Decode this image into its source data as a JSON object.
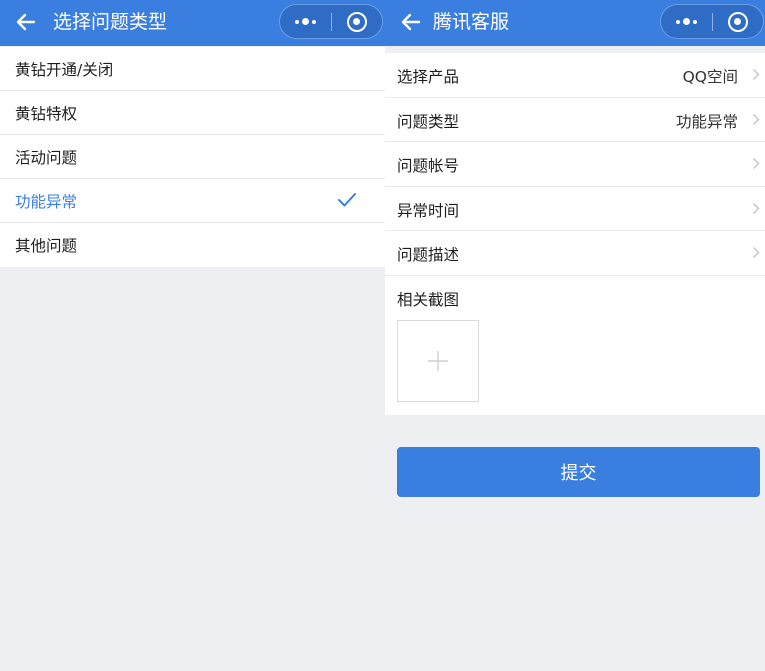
{
  "left": {
    "nav": {
      "title": "选择问题类型"
    },
    "options": [
      {
        "label": "黄钻开通/关闭",
        "selected": false
      },
      {
        "label": "黄钻特权",
        "selected": false
      },
      {
        "label": "活动问题",
        "selected": false
      },
      {
        "label": "功能异常",
        "selected": true
      },
      {
        "label": "其他问题",
        "selected": false
      }
    ]
  },
  "right": {
    "nav": {
      "title": "腾讯客服"
    },
    "form": {
      "rows": [
        {
          "label": "选择产品",
          "value": "QQ空间"
        },
        {
          "label": "问题类型",
          "value": "功能异常"
        },
        {
          "label": "问题帐号",
          "value": ""
        },
        {
          "label": "异常时间",
          "value": ""
        },
        {
          "label": "问题描述",
          "value": ""
        }
      ],
      "screenshot_label": "相关截图"
    },
    "submit_label": "提交"
  },
  "icons": {
    "back": "arrow-left-icon",
    "more": "more-dots-icon",
    "close": "target-circle-icon",
    "check": "checkmark-icon",
    "chevron": "chevron-right-icon",
    "add": "plus-icon"
  },
  "colors": {
    "accent": "#3a7ee0",
    "background": "#eeeff3",
    "surface": "#ffffff"
  }
}
